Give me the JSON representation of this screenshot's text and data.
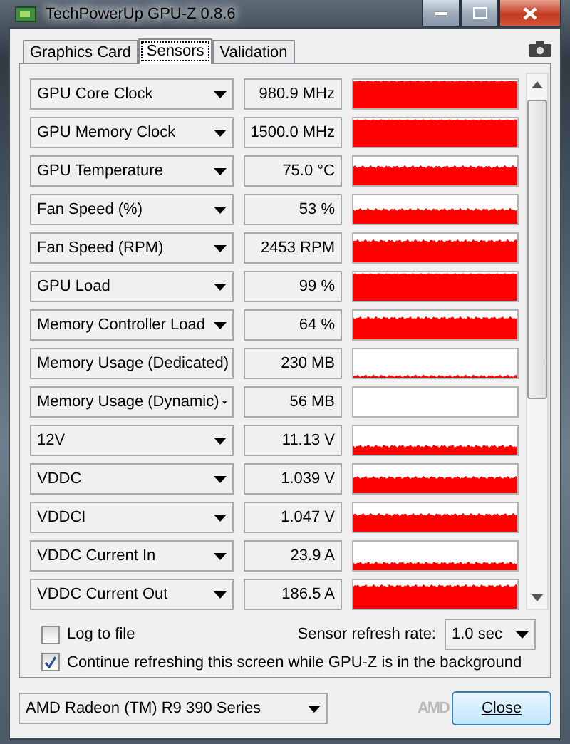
{
  "window": {
    "title": "TechPowerUp GPU-Z 0.8.6"
  },
  "tabs": [
    {
      "label": "Graphics Card",
      "selected": false
    },
    {
      "label": "Sensors",
      "selected": true
    },
    {
      "label": "Validation",
      "selected": false
    }
  ],
  "sensors": [
    {
      "name": "GPU Core Clock",
      "value": "980.9 MHz"
    },
    {
      "name": "GPU Memory Clock",
      "value": "1500.0 MHz"
    },
    {
      "name": "GPU Temperature",
      "value": "75.0 °C"
    },
    {
      "name": "Fan Speed (%)",
      "value": "53 %"
    },
    {
      "name": "Fan Speed (RPM)",
      "value": "2453 RPM"
    },
    {
      "name": "GPU Load",
      "value": "99 %"
    },
    {
      "name": "Memory Controller Load",
      "value": "64 %"
    },
    {
      "name": "Memory Usage (Dedicated)",
      "value": "230 MB"
    },
    {
      "name": "Memory Usage (Dynamic)",
      "value": "56 MB"
    },
    {
      "name": "12V",
      "value": "11.13 V"
    },
    {
      "name": "VDDC",
      "value": "1.039 V"
    },
    {
      "name": "VDDCI",
      "value": "1.047 V"
    },
    {
      "name": "VDDC Current In",
      "value": "23.9 A"
    },
    {
      "name": "VDDC Current Out",
      "value": "186.5 A"
    }
  ],
  "log_to_file": {
    "label": "Log to file",
    "checked": false
  },
  "refresh_rate": {
    "label": "Sensor refresh rate:",
    "value": "1.0 sec"
  },
  "continue_refreshing": {
    "label": "Continue refreshing this screen while GPU-Z is in the background",
    "checked": true
  },
  "gpu_select": {
    "value": "AMD Radeon (TM) R9 390 Series"
  },
  "logo": "AMD",
  "close_button": "Close"
}
